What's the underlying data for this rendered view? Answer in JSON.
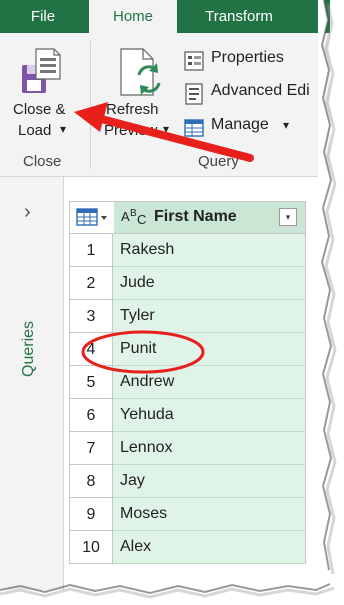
{
  "ribbon": {
    "tabs": [
      {
        "label": "File"
      },
      {
        "label": "Home"
      },
      {
        "label": "Transform"
      }
    ],
    "close_load": {
      "line1": "Close &",
      "line2": "Load"
    },
    "refresh_preview": {
      "line1": "Refresh",
      "line2": "Preview"
    },
    "properties_label": "Properties",
    "advanced_editor_label": "Advanced Edi",
    "manage_label": "Manage",
    "groups": {
      "close": "Close",
      "query": "Query"
    },
    "dropdown_glyph": "▾"
  },
  "queries_pane": {
    "label": "Queries",
    "chevron": "›"
  },
  "grid": {
    "column": {
      "type_icon": "ABC",
      "title": "First Name"
    },
    "rows": [
      {
        "num": "1",
        "value": "Rakesh"
      },
      {
        "num": "2",
        "value": "Jude"
      },
      {
        "num": "3",
        "value": "Tyler"
      },
      {
        "num": "4",
        "value": "Punit"
      },
      {
        "num": "5",
        "value": "Andrew"
      },
      {
        "num": "6",
        "value": "Yehuda"
      },
      {
        "num": "7",
        "value": "Lennox"
      },
      {
        "num": "8",
        "value": "Jay"
      },
      {
        "num": "9",
        "value": "Moses"
      },
      {
        "num": "10",
        "value": "Alex"
      }
    ]
  },
  "colors": {
    "accent": "#217346",
    "column_fill": "#dff3e6",
    "annotation": "#e8201c"
  }
}
